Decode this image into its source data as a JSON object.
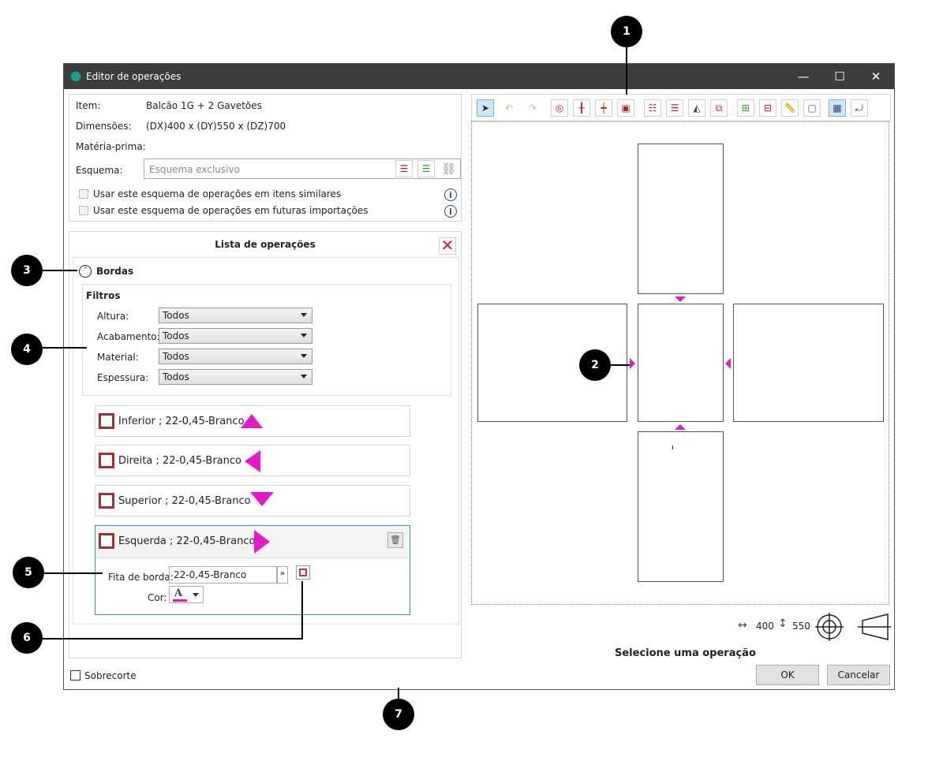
{
  "window": {
    "title": "Editor de operações",
    "controls": [
      "—",
      "☐",
      "✕"
    ]
  },
  "info": {
    "item_label": "Item:",
    "item_value": "Balcão 1G + 2 Gavetões",
    "dims_label": "Dimensões:",
    "dims_value": "(DX)400 x (DY)550 x (DZ)700",
    "material_label": "Matéria-prima:",
    "scheme_label": "Esquema:",
    "scheme_placeholder": "Esquema exclusivo",
    "check_similar": "Usar este esquema de operações em itens similares",
    "check_future": "Usar este esquema de operações em futuras importações"
  },
  "ops": {
    "title": "Lista de operações",
    "group_label": "Bordas",
    "filters_title": "Filtros",
    "filters": [
      {
        "label": "Altura:",
        "value": "Todos"
      },
      {
        "label": "Acabamento:",
        "value": "Todos"
      },
      {
        "label": "Material:",
        "value": "Todos"
      },
      {
        "label": "Espessura:",
        "value": "Todos"
      }
    ],
    "edges": [
      {
        "label": "Inferior ; 22-0,45-Branco",
        "dir": "up"
      },
      {
        "label": "Direita ; 22-0,45-Branco",
        "dir": "left"
      },
      {
        "label": "Superior ; 22-0,45-Branco",
        "dir": "down"
      },
      {
        "label": "Esquerda ; 22-0,45-Branco",
        "dir": "right"
      }
    ],
    "tape_label": "Fita de borda:",
    "tape_value": "22-0,45-Branco",
    "color_label": "Cor:",
    "color_glyph": "A"
  },
  "footer": {
    "sobrecorte": "Sobrecorte",
    "ok": "OK",
    "cancel": "Cancelar"
  },
  "canvas": {
    "width_value": "400",
    "height_value": "550",
    "status": "Selecione uma operação"
  },
  "callouts": [
    "1",
    "2",
    "3",
    "4",
    "5",
    "6",
    "7"
  ],
  "colors": {
    "accent_magenta": "#e619c8",
    "edge_red": "#a23030",
    "titlebar": "#3c3c3c",
    "selection_blue": "#3a8ed0"
  }
}
